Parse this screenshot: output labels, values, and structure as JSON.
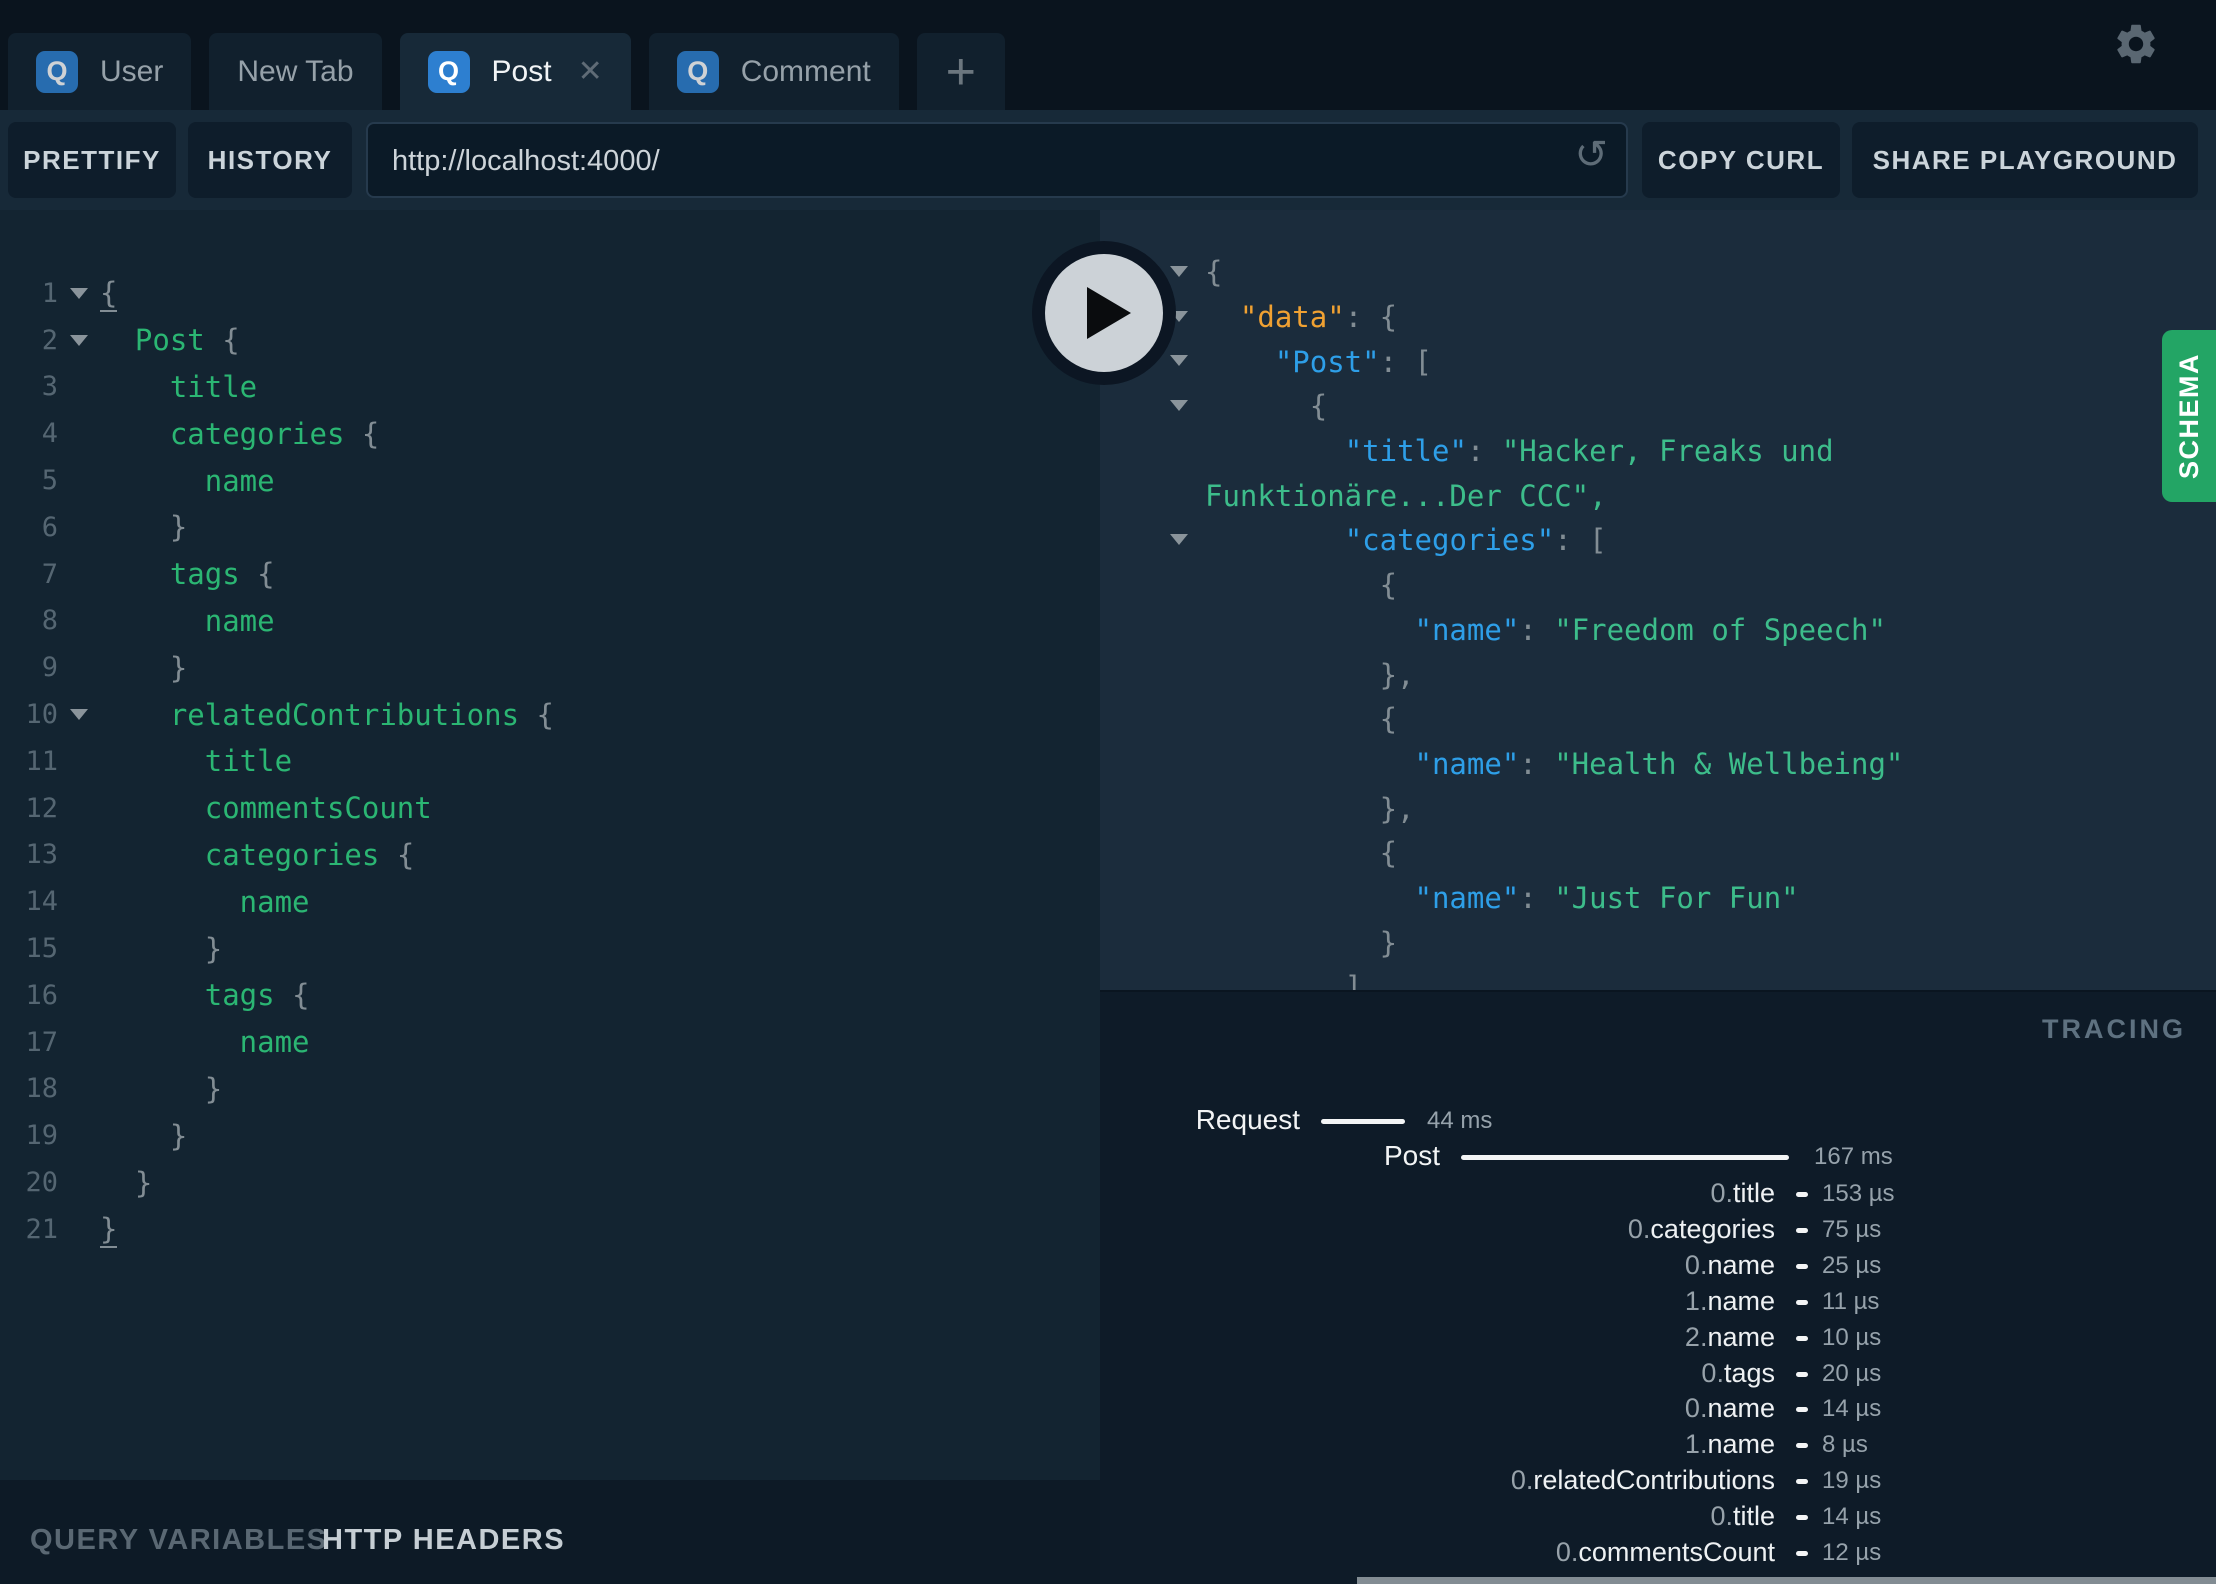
{
  "tabs": {
    "items": [
      {
        "label": "User",
        "badge": "Q",
        "active": false,
        "closable": false
      },
      {
        "label": "New Tab",
        "badge": "",
        "active": false,
        "closable": false
      },
      {
        "label": "Post",
        "badge": "Q",
        "active": true,
        "closable": true
      },
      {
        "label": "Comment",
        "badge": "Q",
        "active": false,
        "closable": false
      }
    ],
    "add_label": "+",
    "close_glyph": "✕"
  },
  "toolbar": {
    "prettify": "PRETTIFY",
    "history": "HISTORY",
    "url": "http://localhost:4000/",
    "reset_icon": "↺",
    "copy_curl": "COPY CURL",
    "share": "SHARE PLAYGROUND"
  },
  "editor": {
    "lines": [
      {
        "num": 1,
        "fold": true,
        "tokens": [
          {
            "t": "{",
            "c": "pm"
          }
        ]
      },
      {
        "num": 2,
        "fold": true,
        "tokens": [
          {
            "t": "  ",
            "c": "p"
          },
          {
            "t": "Post ",
            "c": "f"
          },
          {
            "t": "{",
            "c": "p"
          }
        ]
      },
      {
        "num": 3,
        "fold": false,
        "tokens": [
          {
            "t": "    title",
            "c": "f"
          }
        ]
      },
      {
        "num": 4,
        "fold": false,
        "tokens": [
          {
            "t": "    categories ",
            "c": "f"
          },
          {
            "t": "{",
            "c": "p"
          }
        ]
      },
      {
        "num": 5,
        "fold": false,
        "tokens": [
          {
            "t": "      name",
            "c": "f"
          }
        ]
      },
      {
        "num": 6,
        "fold": false,
        "tokens": [
          {
            "t": "    }",
            "c": "p"
          }
        ]
      },
      {
        "num": 7,
        "fold": false,
        "tokens": [
          {
            "t": "    tags ",
            "c": "f"
          },
          {
            "t": "{",
            "c": "p"
          }
        ]
      },
      {
        "num": 8,
        "fold": false,
        "tokens": [
          {
            "t": "      name",
            "c": "f"
          }
        ]
      },
      {
        "num": 9,
        "fold": false,
        "tokens": [
          {
            "t": "    }",
            "c": "p"
          }
        ]
      },
      {
        "num": 10,
        "fold": true,
        "tokens": [
          {
            "t": "    relatedContributions ",
            "c": "f"
          },
          {
            "t": "{",
            "c": "p"
          }
        ]
      },
      {
        "num": 11,
        "fold": false,
        "tokens": [
          {
            "t": "      title",
            "c": "f"
          }
        ]
      },
      {
        "num": 12,
        "fold": false,
        "tokens": [
          {
            "t": "      commentsCount",
            "c": "f"
          }
        ]
      },
      {
        "num": 13,
        "fold": false,
        "tokens": [
          {
            "t": "      categories ",
            "c": "f"
          },
          {
            "t": "{",
            "c": "p"
          }
        ]
      },
      {
        "num": 14,
        "fold": false,
        "tokens": [
          {
            "t": "        name",
            "c": "f"
          }
        ]
      },
      {
        "num": 15,
        "fold": false,
        "tokens": [
          {
            "t": "      }",
            "c": "p"
          }
        ]
      },
      {
        "num": 16,
        "fold": false,
        "tokens": [
          {
            "t": "      tags ",
            "c": "f"
          },
          {
            "t": "{",
            "c": "p"
          }
        ]
      },
      {
        "num": 17,
        "fold": false,
        "tokens": [
          {
            "t": "        name",
            "c": "f"
          }
        ]
      },
      {
        "num": 18,
        "fold": false,
        "tokens": [
          {
            "t": "      }",
            "c": "p"
          }
        ]
      },
      {
        "num": 19,
        "fold": false,
        "tokens": [
          {
            "t": "    }",
            "c": "p"
          }
        ]
      },
      {
        "num": 20,
        "fold": false,
        "tokens": [
          {
            "t": "  }",
            "c": "p"
          }
        ]
      },
      {
        "num": 21,
        "fold": false,
        "tokens": [
          {
            "t": "}",
            "c": "pm"
          }
        ]
      }
    ]
  },
  "response": {
    "lines": [
      {
        "fold": true,
        "tokens": [
          {
            "t": "{",
            "c": "p"
          }
        ]
      },
      {
        "fold": true,
        "tokens": [
          {
            "t": "  ",
            "c": "p"
          },
          {
            "t": "\"data\"",
            "c": "ko"
          },
          {
            "t": ": ",
            "c": "p"
          },
          {
            "t": "{",
            "c": "p"
          }
        ]
      },
      {
        "fold": true,
        "tokens": [
          {
            "t": "    ",
            "c": "p"
          },
          {
            "t": "\"Post\"",
            "c": "kb"
          },
          {
            "t": ": ",
            "c": "p"
          },
          {
            "t": "[",
            "c": "p"
          }
        ]
      },
      {
        "fold": true,
        "tokens": [
          {
            "t": "      {",
            "c": "p"
          }
        ]
      },
      {
        "fold": false,
        "tokens": [
          {
            "t": "        ",
            "c": "p"
          },
          {
            "t": "\"title\"",
            "c": "kb"
          },
          {
            "t": ": ",
            "c": "p"
          },
          {
            "t": "\"Hacker, Freaks und",
            "c": "s"
          }
        ]
      },
      {
        "fold": false,
        "tokens": [
          {
            "t": "Funktionäre...Der CCC\",",
            "c": "s"
          }
        ]
      },
      {
        "fold": true,
        "tokens": [
          {
            "t": "        ",
            "c": "p"
          },
          {
            "t": "\"categories\"",
            "c": "kb"
          },
          {
            "t": ": ",
            "c": "p"
          },
          {
            "t": "[",
            "c": "p"
          }
        ]
      },
      {
        "fold": false,
        "tokens": [
          {
            "t": "          {",
            "c": "p"
          }
        ]
      },
      {
        "fold": false,
        "tokens": [
          {
            "t": "            ",
            "c": "p"
          },
          {
            "t": "\"name\"",
            "c": "kb"
          },
          {
            "t": ": ",
            "c": "p"
          },
          {
            "t": "\"Freedom of Speech\"",
            "c": "s"
          }
        ]
      },
      {
        "fold": false,
        "tokens": [
          {
            "t": "          },",
            "c": "p"
          }
        ]
      },
      {
        "fold": false,
        "tokens": [
          {
            "t": "          {",
            "c": "p"
          }
        ]
      },
      {
        "fold": false,
        "tokens": [
          {
            "t": "            ",
            "c": "p"
          },
          {
            "t": "\"name\"",
            "c": "kb"
          },
          {
            "t": ": ",
            "c": "p"
          },
          {
            "t": "\"Health & Wellbeing\"",
            "c": "s"
          }
        ]
      },
      {
        "fold": false,
        "tokens": [
          {
            "t": "          },",
            "c": "p"
          }
        ]
      },
      {
        "fold": false,
        "tokens": [
          {
            "t": "          {",
            "c": "p"
          }
        ]
      },
      {
        "fold": false,
        "tokens": [
          {
            "t": "            ",
            "c": "p"
          },
          {
            "t": "\"name\"",
            "c": "kb"
          },
          {
            "t": ": ",
            "c": "p"
          },
          {
            "t": "\"Just For Fun\"",
            "c": "s"
          }
        ]
      },
      {
        "fold": false,
        "tokens": [
          {
            "t": "          }",
            "c": "p"
          }
        ]
      },
      {
        "fold": false,
        "tokens": [
          {
            "t": "        ]",
            "c": "p"
          }
        ]
      }
    ]
  },
  "tracing": {
    "title": "TRACING",
    "requests": [
      {
        "label": "Request",
        "value": "44 ms"
      },
      {
        "label": "Post",
        "value": "167 ms"
      }
    ],
    "fields": [
      {
        "prefix": "0.",
        "name": "title",
        "value": "153 µs"
      },
      {
        "prefix": "0.",
        "name": "categories",
        "value": "75 µs"
      },
      {
        "prefix": "0.",
        "name": "name",
        "value": "25 µs"
      },
      {
        "prefix": "1.",
        "name": "name",
        "value": "11 µs"
      },
      {
        "prefix": "2.",
        "name": "name",
        "value": "10 µs"
      },
      {
        "prefix": "0.",
        "name": "tags",
        "value": "20 µs"
      },
      {
        "prefix": "0.",
        "name": "name",
        "value": "14 µs"
      },
      {
        "prefix": "1.",
        "name": "name",
        "value": "8 µs"
      },
      {
        "prefix": "0.",
        "name": "relatedContributions",
        "value": "19 µs"
      },
      {
        "prefix": "0.",
        "name": "title",
        "value": "14 µs"
      },
      {
        "prefix": "0.",
        "name": "commentsCount",
        "value": "12 µs"
      }
    ]
  },
  "schema_tab": "SCHEMA",
  "footer": {
    "query_variables": "QUERY VARIABLES",
    "http_headers": "HTTP HEADERS"
  },
  "colors": {
    "schema_green": "#23a565",
    "badge_blue": "#2d7fd0",
    "key_orange": "#f0a132",
    "key_blue": "#2e9fe8",
    "string_green": "#3dbd8b",
    "field_green": "#2bb673"
  }
}
